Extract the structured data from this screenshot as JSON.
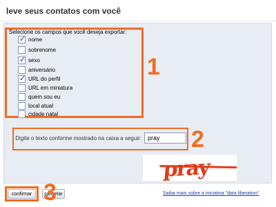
{
  "header": {
    "title": "leve seus contatos com você"
  },
  "fields": {
    "title": "Selecione os campos que você deseja exportar:",
    "items": [
      {
        "label": "nome",
        "checked": true
      },
      {
        "label": "sobrenome",
        "checked": false
      },
      {
        "label": "sexo",
        "checked": true
      },
      {
        "label": "aniversário",
        "checked": false
      },
      {
        "label": "URL do perfil",
        "checked": true
      },
      {
        "label": "URL em miniatura",
        "checked": false
      },
      {
        "label": "quem sou eu",
        "checked": false
      },
      {
        "label": "local atual",
        "checked": false
      },
      {
        "label": "cidade natal",
        "checked": false
      }
    ]
  },
  "captcha": {
    "prompt": "Digite o texto conforme mostrado na caixa a seguir:",
    "input_value": "pray",
    "image_text": "pray"
  },
  "actions": {
    "confirm_label": "confirmar",
    "cancel_label": "cancelar",
    "info_link": "Saiba mais sobre a iniciativa \"data liberation\""
  },
  "step_markers": [
    "1",
    "2",
    "3"
  ],
  "colors": {
    "accent": "#f26b21",
    "panel": "#e8ecf3",
    "link": "#1a3fa0",
    "captcha": "#e23b1a"
  }
}
